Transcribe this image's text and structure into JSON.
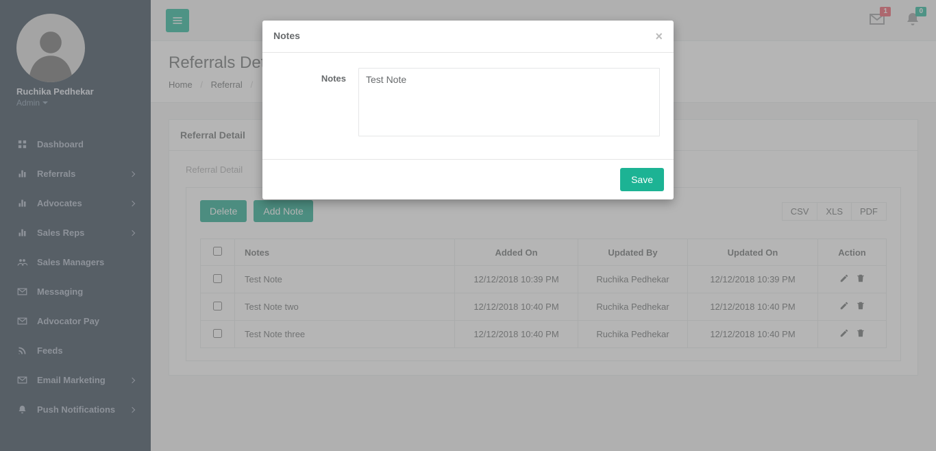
{
  "user": {
    "name": "Ruchika Pedhekar",
    "role": "Admin"
  },
  "sidebar": {
    "items": [
      {
        "label": "Dashboard",
        "has_chevron": false
      },
      {
        "label": "Referrals",
        "has_chevron": true
      },
      {
        "label": "Advocates",
        "has_chevron": true
      },
      {
        "label": "Sales Reps",
        "has_chevron": true
      },
      {
        "label": "Sales Managers",
        "has_chevron": false
      },
      {
        "label": "Messaging",
        "has_chevron": false
      },
      {
        "label": "Advocator Pay",
        "has_chevron": false
      },
      {
        "label": "Feeds",
        "has_chevron": false
      },
      {
        "label": "Email Marketing",
        "has_chevron": true
      },
      {
        "label": "Push Notifications",
        "has_chevron": true
      }
    ]
  },
  "topbar": {
    "mail_badge": "1",
    "bell_badge": "0"
  },
  "page": {
    "title": "Referrals Detail",
    "breadcrumb": {
      "home": "Home",
      "referral": "Referral"
    }
  },
  "panel": {
    "heading": "Referral Detail",
    "sub": "Referral Detail"
  },
  "buttons": {
    "delete": "Delete",
    "add_note": "Add Note",
    "csv": "CSV",
    "xls": "XLS",
    "pdf": "PDF"
  },
  "table": {
    "headers": {
      "notes": "Notes",
      "added_on": "Added On",
      "updated_by": "Updated By",
      "updated_on": "Updated On",
      "action": "Action"
    },
    "rows": [
      {
        "note": "Test Note",
        "added_on": "12/12/2018 10:39 PM",
        "updated_by": "Ruchika Pedhekar",
        "updated_on": "12/12/2018 10:39 PM"
      },
      {
        "note": "Test Note two",
        "added_on": "12/12/2018 10:40 PM",
        "updated_by": "Ruchika Pedhekar",
        "updated_on": "12/12/2018 10:40 PM"
      },
      {
        "note": "Test Note three",
        "added_on": "12/12/2018 10:40 PM",
        "updated_by": "Ruchika Pedhekar",
        "updated_on": "12/12/2018 10:40 PM"
      }
    ]
  },
  "modal": {
    "title": "Notes",
    "label": "Notes",
    "value": "Test Note",
    "save": "Save"
  }
}
